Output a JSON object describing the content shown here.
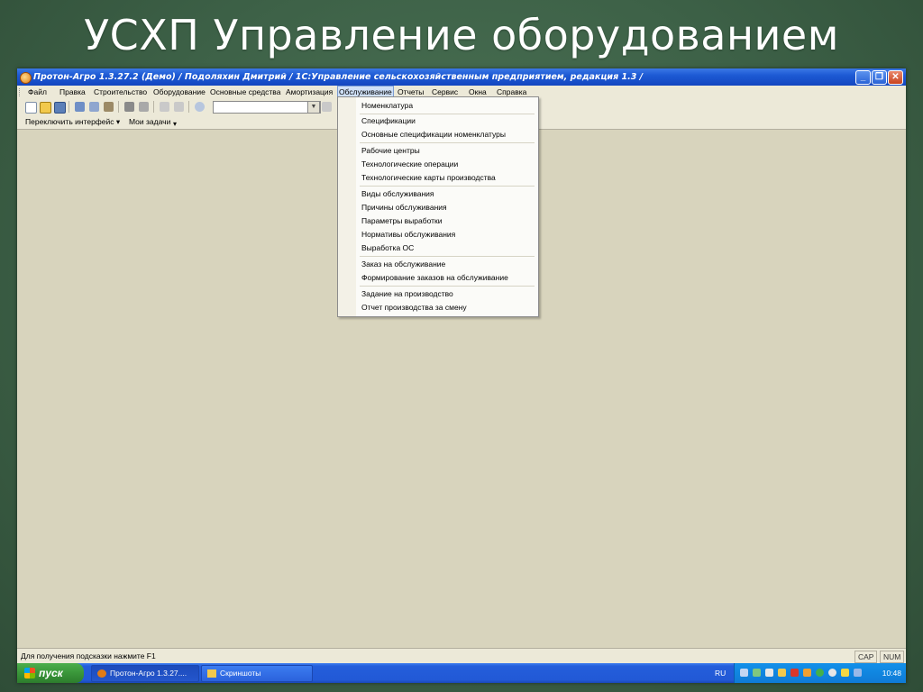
{
  "slide": {
    "title": "УСХП Управление оборудованием"
  },
  "window": {
    "title": "Протон-Агро 1.3.27.2 (Демо) / Подоляхин Дмитрий / 1С:Управление сельскохозяйственным предприятием, редакция 1.3 /",
    "minimize": "_",
    "maximize": "❐",
    "close": "✕"
  },
  "menubar": {
    "items": [
      "Файл",
      "Правка",
      "Строительство",
      "Оборудование",
      "Основные средства",
      "Амортизация",
      "Обслуживание",
      "Отчеты",
      "Сервис",
      "Окна",
      "Справка"
    ],
    "active": "Обслуживание"
  },
  "panelbar": {
    "switch_interface": "Переключить интерфейс ▾",
    "my_tasks": "Мои задачи"
  },
  "dropdown": {
    "items": [
      "Номенклатура",
      "Спецификации",
      "Основные спецификации номенклатуры",
      "Рабочие центры",
      "Технологические операции",
      "Технологические карты производства",
      "Виды обслуживания",
      "Причины обслуживания",
      "Параметры выработки",
      "Нормативы обслуживания",
      "Выработка ОС",
      "Заказ на обслуживание",
      "Формирование заказов на обслуживание",
      "Задание на производство",
      "Отчет производства за смену"
    ]
  },
  "statusbar": {
    "hint": "Для получения подсказки нажмите F1",
    "cap": "CAP",
    "num": "NUM"
  },
  "taskbar": {
    "start": "пуск",
    "tasks": [
      "Протон-Агро 1.3.27....",
      "Скриншоты"
    ],
    "lang": "RU",
    "clock": "10:48"
  },
  "colors": {
    "slide_bg": "#3d6147",
    "titlebar": "#1d5ad4",
    "workspace": "#d8d4bd",
    "menu_bg": "#ece9d8",
    "start_button": "#3a963a"
  }
}
